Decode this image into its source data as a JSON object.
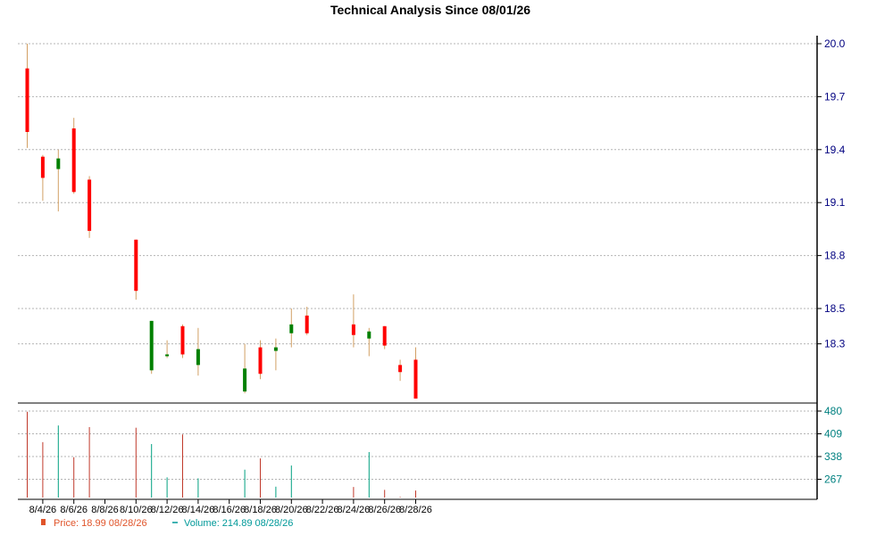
{
  "chart_data": {
    "type": "candlestick",
    "title": "Technical Analysis Since 08/01/26",
    "price_panel": {
      "ylim": [
        18.0,
        20.0
      ],
      "yticks": [
        "20.0",
        "19.7",
        "19.4",
        "19.1",
        "18.8",
        "18.5",
        "18.3"
      ],
      "tick_color": "#000080",
      "up_color": "#008000",
      "down_color": "#ff0000",
      "wick_color": "#d2a064",
      "grid": true
    },
    "volume_panel": {
      "ylim": [
        210,
        480
      ],
      "yticks": [
        "480",
        "409",
        "338",
        "267"
      ],
      "tick_color": "#008080",
      "up_color": "#00a080",
      "down_color": "#c0392b",
      "grid": true
    },
    "x_range": [
      "8/3/26",
      "8/28/26"
    ],
    "xticks": [
      "8/4/26",
      "8/6/26",
      "8/8/26",
      "8/10/26",
      "8/12/26",
      "8/14/26",
      "8/16/26",
      "8/18/26",
      "8/20/26",
      "8/22/26",
      "8/24/26",
      "8/26/26",
      "8/28/26"
    ],
    "candles": [
      {
        "date": "8/3/26",
        "open": 19.5,
        "high": 20.0,
        "low": 19.41,
        "close": 19.86,
        "volume": 478,
        "color": "down"
      },
      {
        "date": "8/4/26",
        "open": 19.36,
        "high": 19.37,
        "low": 19.11,
        "close": 19.24,
        "volume": 383,
        "color": "down"
      },
      {
        "date": "8/5/26",
        "open": 19.29,
        "high": 19.4,
        "low": 19.05,
        "close": 19.35,
        "volume": 435,
        "color": "up"
      },
      {
        "date": "8/6/26",
        "open": 19.16,
        "high": 19.58,
        "low": 19.15,
        "close": 19.52,
        "volume": 336,
        "color": "down"
      },
      {
        "date": "8/7/26",
        "open": 18.94,
        "high": 19.25,
        "low": 18.9,
        "close": 19.23,
        "volume": 430,
        "color": "down"
      },
      {
        "date": "8/10/26",
        "open": 18.6,
        "high": 18.89,
        "low": 18.55,
        "close": 18.89,
        "volume": 428,
        "color": "down"
      },
      {
        "date": "8/11/26",
        "open": 18.15,
        "high": 18.43,
        "low": 18.13,
        "close": 18.43,
        "volume": 377,
        "color": "up"
      },
      {
        "date": "8/12/26",
        "open": 18.24,
        "high": 18.32,
        "low": 18.22,
        "close": 18.23,
        "volume": 273,
        "color": "up"
      },
      {
        "date": "8/13/26",
        "open": 18.4,
        "high": 18.41,
        "low": 18.22,
        "close": 18.24,
        "volume": 407,
        "color": "down"
      },
      {
        "date": "8/14/26",
        "open": 18.27,
        "high": 18.39,
        "low": 18.12,
        "close": 18.18,
        "volume": 270,
        "color": "up"
      },
      {
        "date": "8/17/26",
        "open": 18.16,
        "high": 18.3,
        "low": 18.02,
        "close": 18.03,
        "volume": 297,
        "color": "up"
      },
      {
        "date": "8/18/26",
        "open": 18.13,
        "high": 18.32,
        "low": 18.1,
        "close": 18.28,
        "volume": 332,
        "color": "down"
      },
      {
        "date": "8/19/26",
        "open": 18.28,
        "high": 18.33,
        "low": 18.15,
        "close": 18.26,
        "volume": 244,
        "color": "up"
      },
      {
        "date": "8/20/26",
        "open": 18.36,
        "high": 18.5,
        "low": 18.28,
        "close": 18.41,
        "volume": 310,
        "color": "up"
      },
      {
        "date": "8/21/26",
        "open": 18.46,
        "high": 18.51,
        "low": 18.35,
        "close": 18.36,
        "volume": 210,
        "color": "down"
      },
      {
        "date": "8/24/26",
        "open": 18.35,
        "high": 18.58,
        "low": 18.28,
        "close": 18.41,
        "volume": 243,
        "color": "down"
      },
      {
        "date": "8/25/26",
        "open": 18.33,
        "high": 18.39,
        "low": 18.23,
        "close": 18.37,
        "volume": 352,
        "color": "up"
      },
      {
        "date": "8/26/26",
        "open": 18.4,
        "high": 18.4,
        "low": 18.27,
        "close": 18.29,
        "volume": 234,
        "color": "down"
      },
      {
        "date": "8/27/26",
        "open": 18.18,
        "high": 18.21,
        "low": 18.09,
        "close": 18.14,
        "volume": 212,
        "color": "down"
      },
      {
        "date": "8/28/26",
        "open": 18.21,
        "high": 18.28,
        "low": 18.0,
        "close": 17.99,
        "volume": 232,
        "color": "down"
      }
    ],
    "legend": {
      "price_label": "Price: 18.99  08/28/26",
      "volume_label": "Volume: 214.89  08/28/26",
      "price_color": "#e0542a",
      "volume_color": "#009999"
    }
  }
}
